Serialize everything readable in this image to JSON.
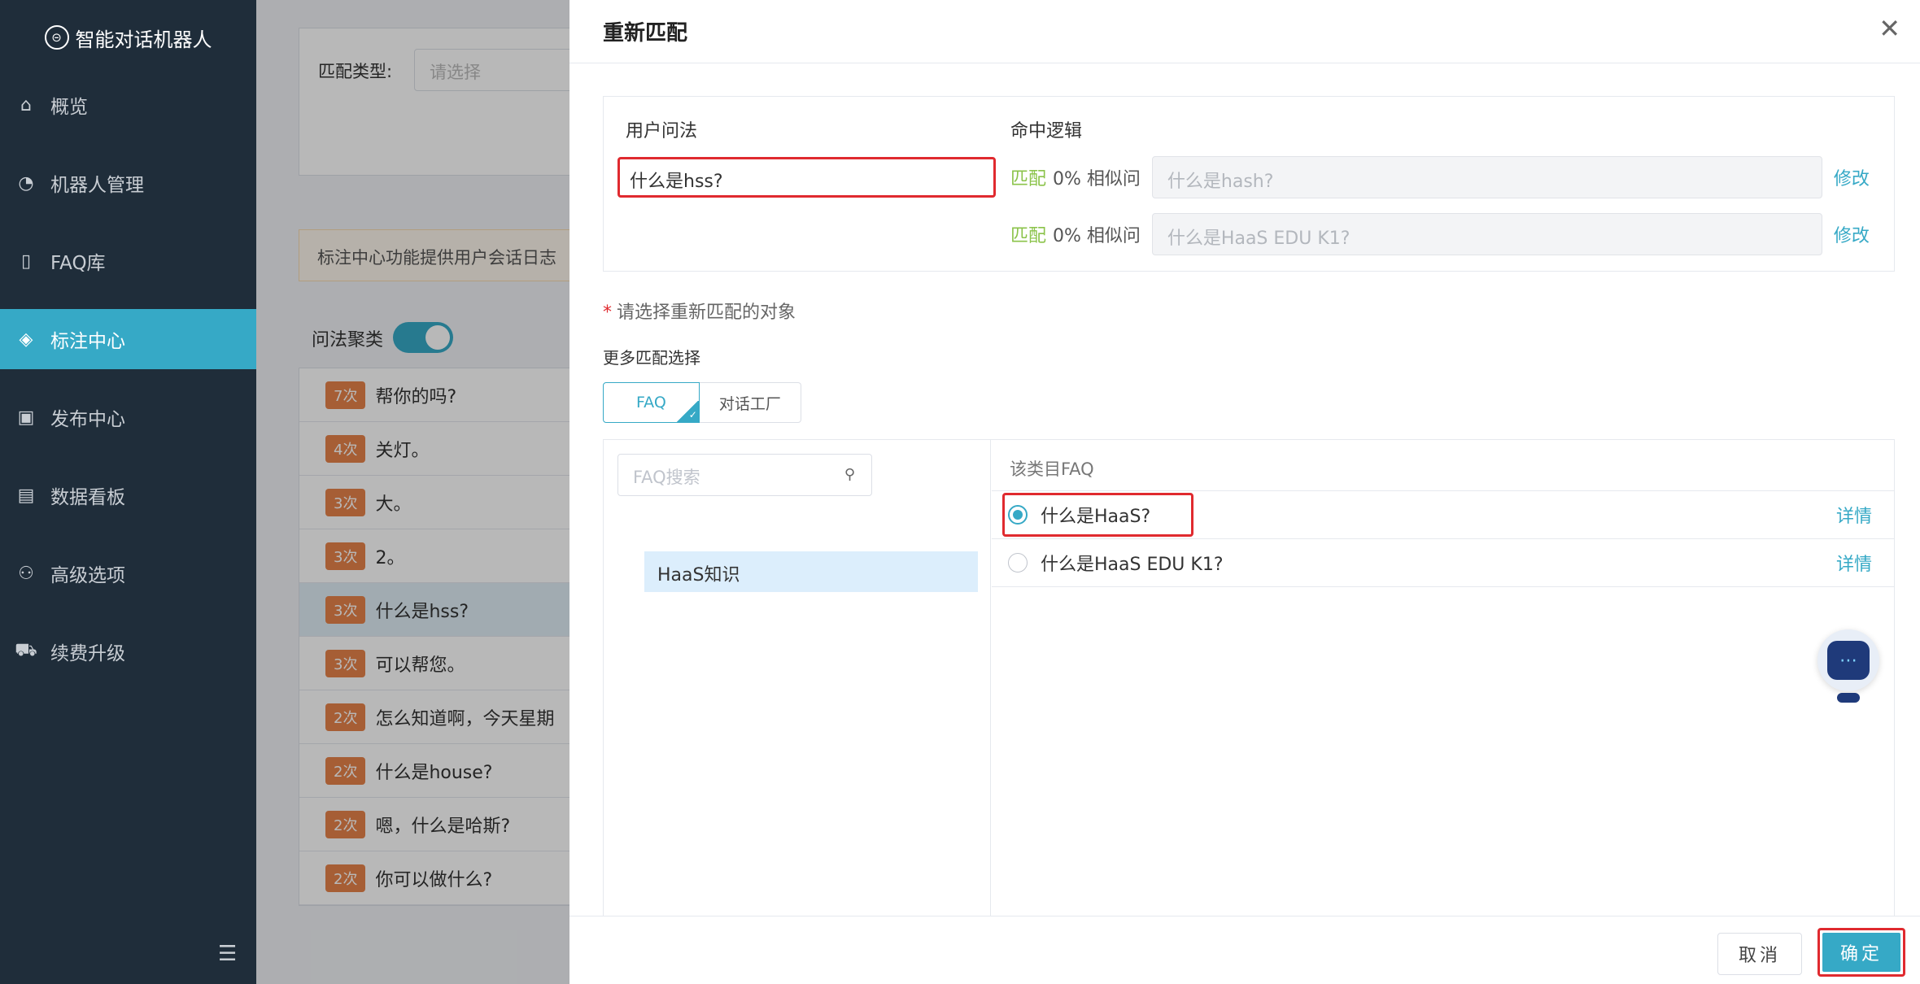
{
  "app": {
    "title": "智能对话机器人"
  },
  "sidebar": {
    "items": [
      {
        "label": "概览",
        "icon": "home-icon",
        "glyph": "⌂",
        "active": false
      },
      {
        "label": "机器人管理",
        "icon": "robot-icon",
        "glyph": "◔",
        "active": false
      },
      {
        "label": "FAQ库",
        "icon": "book-icon",
        "glyph": "▯",
        "active": false
      },
      {
        "label": "标注中心",
        "icon": "tag-icon",
        "glyph": "◈",
        "active": true
      },
      {
        "label": "发布中心",
        "icon": "publish-icon",
        "glyph": "▣",
        "active": false
      },
      {
        "label": "数据看板",
        "icon": "dashboard-icon",
        "glyph": "▤",
        "active": false
      },
      {
        "label": "高级选项",
        "icon": "users-gear-icon",
        "glyph": "⚇",
        "active": false
      },
      {
        "label": "续费升级",
        "icon": "cart-icon",
        "glyph": "⛟",
        "active": false
      }
    ]
  },
  "background": {
    "filter_label": "匹配类型:",
    "filter_placeholder": "请选择",
    "notice": "标注中心功能提供用户会话日志",
    "cluster_label": "问法聚类",
    "questions": [
      {
        "count": "7次",
        "text": "帮你的吗?"
      },
      {
        "count": "4次",
        "text": "关灯。"
      },
      {
        "count": "3次",
        "text": "大。"
      },
      {
        "count": "3次",
        "text": "2。"
      },
      {
        "count": "3次",
        "text": "什么是hss?",
        "selected": true
      },
      {
        "count": "3次",
        "text": "可以帮您。"
      },
      {
        "count": "2次",
        "text": "怎么知道啊，今天星期"
      },
      {
        "count": "2次",
        "text": "什么是house?"
      },
      {
        "count": "2次",
        "text": "嗯，什么是哈斯?"
      },
      {
        "count": "2次",
        "text": "你可以做什么?"
      }
    ]
  },
  "drawer": {
    "title": "重新匹配",
    "user_question_title": "用户问法",
    "hit_logic_title": "命中逻辑",
    "user_question": "什么是hss?",
    "rules": [
      {
        "match": "匹配",
        "pct": "0% 相似问",
        "value": "什么是hash?",
        "edit": "修改"
      },
      {
        "match": "匹配",
        "pct": "0% 相似问",
        "value": "什么是HaaS EDU K1?",
        "edit": "修改"
      }
    ],
    "hint": "请选择重新匹配的对象",
    "more_title": "更多匹配选择",
    "tabs": [
      "FAQ",
      "对话工厂"
    ],
    "search_placeholder": "FAQ搜索",
    "category": "HaaS知识",
    "list_header": "该类目FAQ",
    "faqs": [
      {
        "text": "什么是HaaS?",
        "detail": "详情",
        "selected": true
      },
      {
        "text": "什么是HaaS EDU K1?",
        "detail": "详情",
        "selected": false
      }
    ],
    "cancel": "取消",
    "confirm": "确定"
  },
  "colors": {
    "accent": "#36a9c6",
    "sidebar": "#1f2d3a",
    "highlight": "#e02a2f",
    "match_green": "#8bc34a"
  }
}
